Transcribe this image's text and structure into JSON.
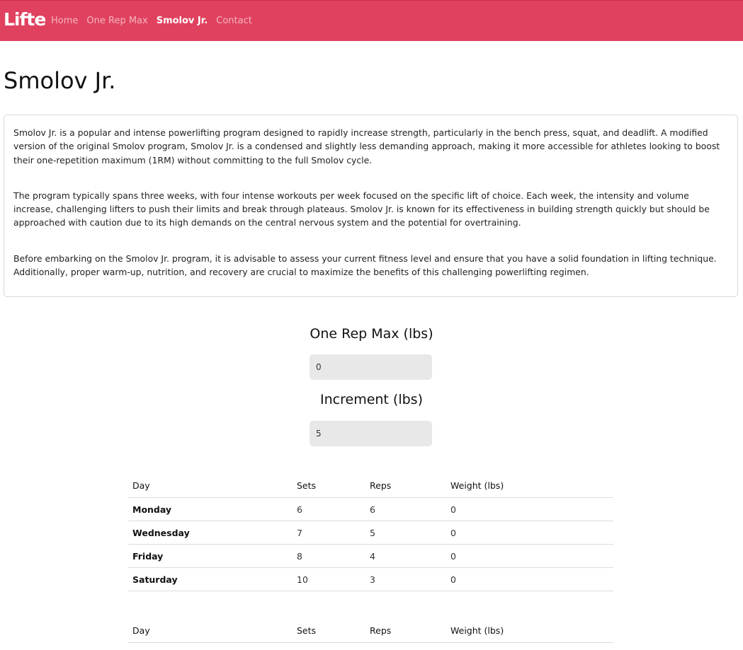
{
  "navbar": {
    "brand": "Lifte",
    "links": [
      "Home",
      "One Rep Max",
      "Smolov Jr.",
      "Contact"
    ],
    "active": "Smolov Jr.",
    "background": "#e0415f"
  },
  "page": {
    "title": "Smolov Jr."
  },
  "description": {
    "paragraphs": [
      "Smolov Jr. is a popular and intense powerlifting program designed to rapidly increase strength, particularly in the bench press, squat, and deadlift. A modified version of the original Smolov program, Smolov Jr. is a condensed and slightly less demanding approach, making it more accessible for athletes looking to boost their one-repetition maximum (1RM) without committing to the full Smolov cycle.",
      "The program typically spans three weeks, with four intense workouts per week focused on the specific lift of choice. Each week, the intensity and volume increase, challenging lifters to push their limits and break through plateaus. Smolov Jr. is known for its effectiveness in building strength quickly but should be approached with caution due to its high demands on the central nervous system and the potential for overtraining.",
      "Before embarking on the Smolov Jr. program, it is advisable to assess your current fitness level and ensure that you have a solid foundation in lifting technique. Additionally, proper warm-up, nutrition, and recovery are crucial to maximize the benefits of this challenging powerlifting regimen."
    ]
  },
  "form": {
    "one_rep_max_label": "One Rep Max (lbs)",
    "one_rep_max_value": "0",
    "increment_label": "Increment (lbs)",
    "increment_value": "5"
  },
  "tables": [
    {
      "headers": [
        "Day",
        "Sets",
        "Reps",
        "Weight (lbs)"
      ],
      "rows": [
        [
          "Monday",
          "6",
          "6",
          "0"
        ],
        [
          "Wednesday",
          "7",
          "5",
          "0"
        ],
        [
          "Friday",
          "8",
          "4",
          "0"
        ],
        [
          "Saturday",
          "10",
          "3",
          "0"
        ]
      ]
    },
    {
      "headers": [
        "Day",
        "Sets",
        "Reps",
        "Weight (lbs)"
      ],
      "rows": []
    }
  ]
}
